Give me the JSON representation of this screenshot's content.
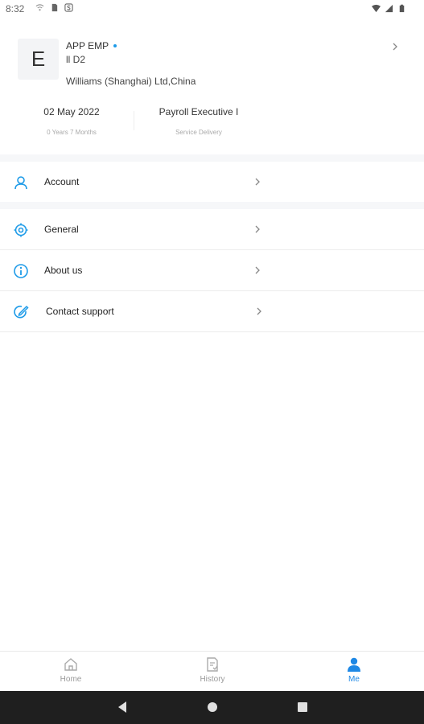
{
  "status_bar": {
    "time": "8:32",
    "left_icons": [
      "wifi-off-icon",
      "sim-card-icon",
      "s-app-icon"
    ],
    "right_icons": [
      "wifi-icon",
      "signal-icon",
      "battery-icon"
    ]
  },
  "profile": {
    "avatar_letter": "E",
    "name": "APP EMP",
    "id": "ll D2",
    "company": "Williams (Shanghai) Ltd,China",
    "stats": [
      {
        "main": "02 May 2022",
        "sub": "0 Years 7 Months"
      },
      {
        "main": "Payroll Executive I",
        "sub": "Service Delivery"
      }
    ]
  },
  "menu": {
    "items": [
      {
        "label": "Account",
        "icon": "person-icon"
      },
      {
        "label": "General",
        "icon": "settings-icon"
      },
      {
        "label": "About us",
        "icon": "info-icon"
      },
      {
        "label": "Contact support",
        "icon": "edit-support-icon"
      }
    ]
  },
  "tabs": [
    {
      "label": "Home",
      "icon": "home-icon",
      "active": false
    },
    {
      "label": "History",
      "icon": "history-icon",
      "active": false
    },
    {
      "label": "Me",
      "icon": "me-person-icon",
      "active": true
    }
  ],
  "colors": {
    "accent": "#1e88e5",
    "icon_blue": "#1e9be8",
    "inactive": "#9a9a9a",
    "nav_bar": "#1f1f1f"
  }
}
